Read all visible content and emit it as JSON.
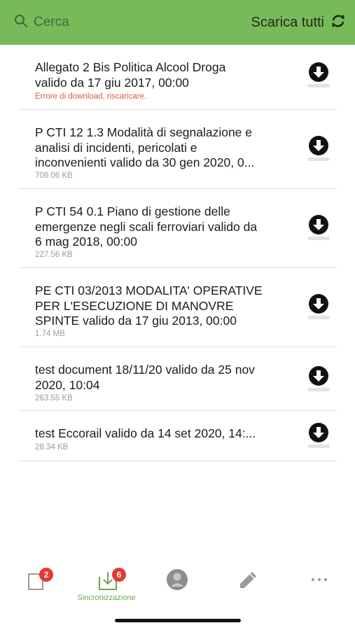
{
  "header": {
    "search_placeholder": "Cerca",
    "download_all_label": "Scarica tutti",
    "bg_color": "#78b95a",
    "icons": {
      "search": "search-icon",
      "sync": "sync-icon"
    }
  },
  "documents": [
    {
      "title": "Allegato 2 Bis Politica Alcool Droga\nvalido da 17 giu 2017, 00:00",
      "subtitle": "Errore di download, riscaricare.",
      "is_error": true
    },
    {
      "title": "P CTI 12 1.3 Modalità di segnalazione e\nanalisi di incidenti, pericolati  e\ninconvenienti valido da 30 gen 2020, 0...",
      "subtitle": "708.06 KB",
      "is_error": false
    },
    {
      "title": "P CTI 54 0.1 Piano di gestione delle\nemergenze negli scali ferroviari valido da\n6 mag 2018, 00:00",
      "subtitle": "227.56 KB",
      "is_error": false
    },
    {
      "title": "PE CTI 03/2013 MODALITA' OPERATIVE\nPER L'ESECUZIONE DI MANOVRE\nSPINTE valido da 17 giu 2013, 00:00",
      "subtitle": "1.74 MB",
      "is_error": false
    },
    {
      "title": "test document 18/11/20 valido da 25 nov\n2020, 10:04",
      "subtitle": "263.55 KB",
      "is_error": false
    },
    {
      "title": "test Eccorail valido da 14 set 2020, 14:...",
      "subtitle": "28.34 KB",
      "is_error": false
    }
  ],
  "tabbar": {
    "tabs": [
      {
        "name": "documents",
        "icon": "document-icon",
        "badge": "2",
        "label": ""
      },
      {
        "name": "sync",
        "icon": "download-tray-icon",
        "badge": "6",
        "label": "Sincronizzazione",
        "active": true
      },
      {
        "name": "profile",
        "icon": "profile-icon",
        "badge": "",
        "label": ""
      },
      {
        "name": "edit",
        "icon": "pencil-icon",
        "badge": "",
        "label": ""
      },
      {
        "name": "more",
        "icon": "more-icon",
        "badge": "",
        "label": ""
      }
    ],
    "active_color": "#6aa84f",
    "badge_color": "#e53935"
  }
}
